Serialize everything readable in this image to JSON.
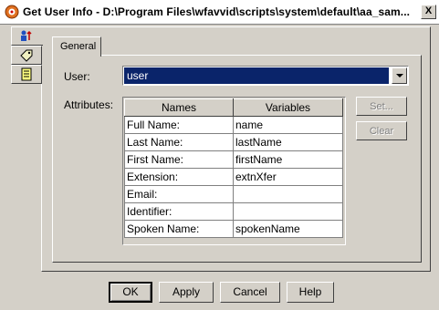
{
  "window": {
    "title": "Get User Info - D:\\Program Files\\wfavvid\\scripts\\system\\default\\aa_sam...",
    "close_label": "X"
  },
  "side_tabs": [
    {
      "icon": "user-info-icon"
    },
    {
      "icon": "tag-icon"
    },
    {
      "icon": "notes-icon"
    }
  ],
  "tab": {
    "general_label": "General"
  },
  "form": {
    "user_label": "User:",
    "user_value": "user",
    "attributes_label": "Attributes:"
  },
  "table": {
    "headers": [
      "Names",
      "Variables"
    ],
    "rows": [
      {
        "name": "Full Name:",
        "variable": "name"
      },
      {
        "name": "Last Name:",
        "variable": "lastName"
      },
      {
        "name": "First Name:",
        "variable": "firstName"
      },
      {
        "name": "Extension:",
        "variable": "extnXfer"
      },
      {
        "name": "Email:",
        "variable": ""
      },
      {
        "name": "Identifier:",
        "variable": ""
      },
      {
        "name": "Spoken Name:",
        "variable": "spokenName"
      }
    ]
  },
  "side_buttons": {
    "set_label": "Set...",
    "clear_label": "Clear"
  },
  "buttons": {
    "ok": "OK",
    "apply": "Apply",
    "cancel": "Cancel",
    "help": "Help"
  },
  "colors": {
    "selection": "#0a246a",
    "face": "#d4d0c8"
  }
}
